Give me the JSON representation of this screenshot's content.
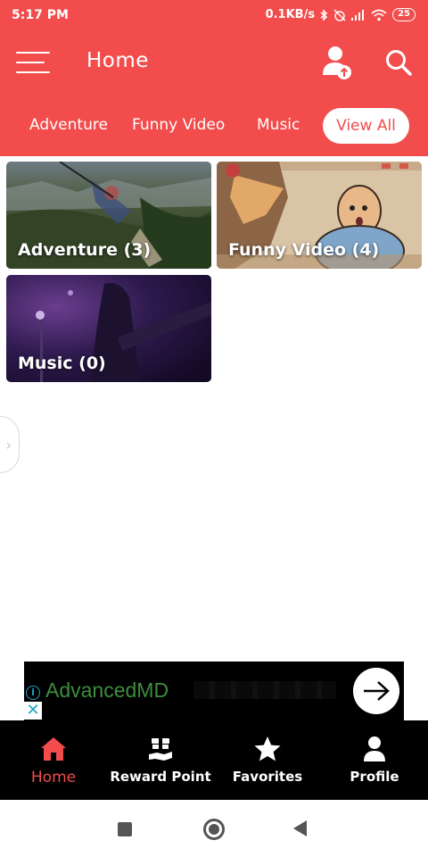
{
  "status_bar": {
    "time": "5:17 PM",
    "speed": "0.1KB/s",
    "battery": "25"
  },
  "app_bar": {
    "title": "Home"
  },
  "tabs": [
    {
      "label": "Adventure"
    },
    {
      "label": "Funny Video"
    },
    {
      "label": "Music"
    },
    {
      "label": "View All",
      "selected": true
    }
  ],
  "categories": [
    {
      "label": "Adventure (3)"
    },
    {
      "label": "Funny Video (4)"
    },
    {
      "label": "Music (0)"
    }
  ],
  "ad": {
    "brand": "AdvancedMD",
    "info_icon": "i",
    "close_icon": "✕"
  },
  "bottom_nav": [
    {
      "label": "Home",
      "icon": "home-icon",
      "active": true
    },
    {
      "label": "Reward Point",
      "icon": "gift-icon"
    },
    {
      "label": "Favorites",
      "icon": "star-icon"
    },
    {
      "label": "Profile",
      "icon": "person-icon"
    }
  ],
  "colors": {
    "accent": "#f24c4c",
    "nav_background": "#000000"
  }
}
